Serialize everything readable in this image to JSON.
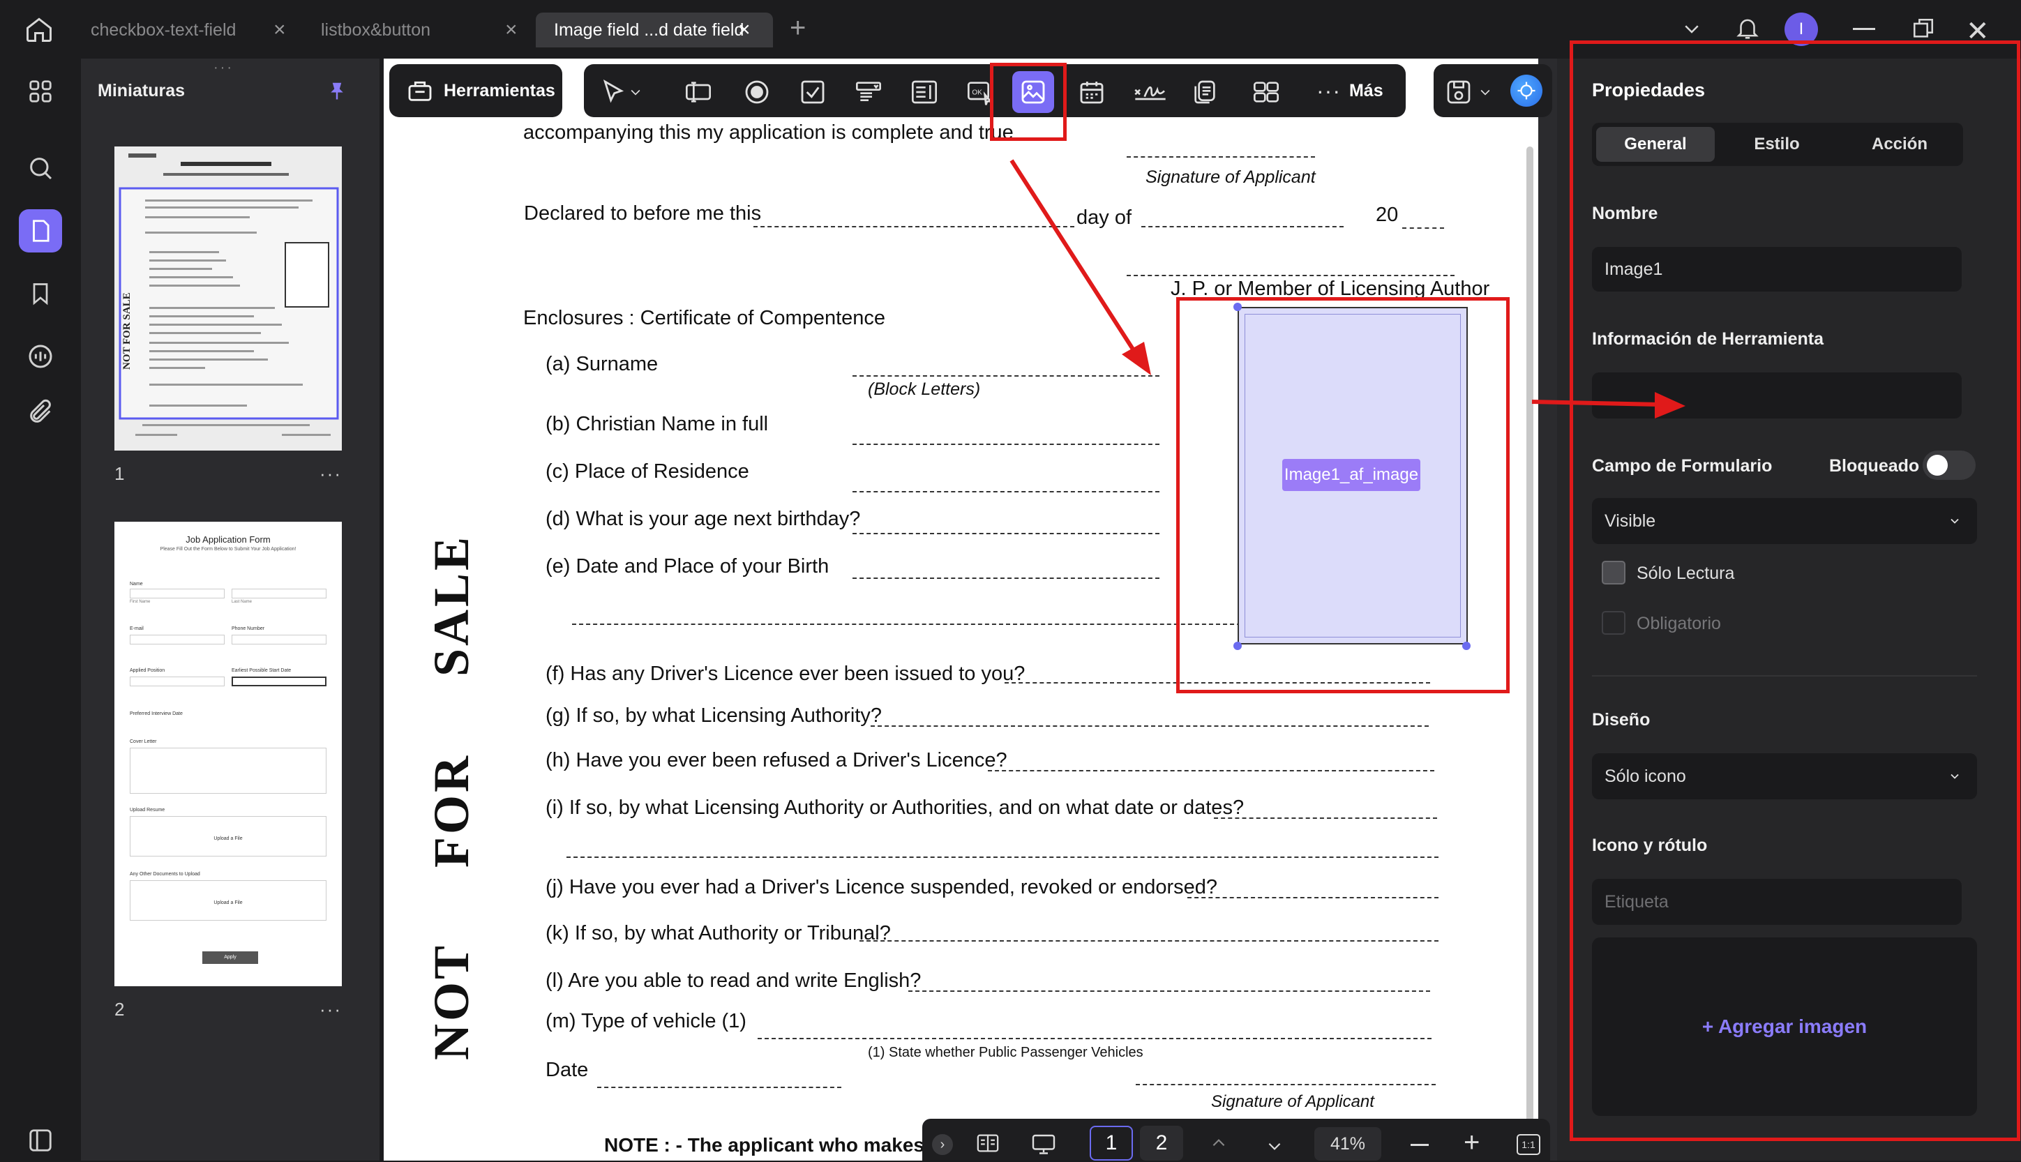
{
  "tabs": [
    {
      "label": "checkbox-text-field"
    },
    {
      "label": "listbox&button"
    },
    {
      "label": "Image field ...d date field"
    }
  ],
  "user_initial": "I",
  "thumbnails": {
    "title": "Miniaturas",
    "pages": [
      {
        "number": "1",
        "more": "···"
      },
      {
        "number": "2",
        "more": "···"
      }
    ],
    "page2": {
      "title": "Job Application Form",
      "subtitle": "Please Fill Out the Form Below to Submit Your Job Application!",
      "name": "Name",
      "first": "First Name",
      "last": "Last Name",
      "email": "E-mail",
      "phone": "Phone Number",
      "position": "Applied Position",
      "start": "Earliest Possible Start Date",
      "interview": "Preferred Interview Date",
      "cover": "Cover Letter",
      "resume": "Upload Resume",
      "other": "Any Other Documents to Upload",
      "upload": "Upload a File",
      "apply": "Apply"
    }
  },
  "toolbar": {
    "tools_label": "Herramientas",
    "more_label": "Más"
  },
  "document": {
    "l_intro": "accompanying this my application is complete and true",
    "sig1": "Signature of Applicant",
    "declared": "Declared to before me this",
    "day_of": "day of",
    "year": "20",
    "jp": "J. P. or Member of Licensing Author",
    "enclosures": "Enclosures :  Certificate of Compentence",
    "a": "(a)  Surname",
    "block": "(Block Letters)",
    "b": "(b)  Christian Name in full",
    "c": "(c)  Place of Residence",
    "d": "(d)  What is your age next birthday?",
    "e": "(e)  Date and Place of your Birth",
    "f": "(f)  Has any Driver's Licence ever been issued to you?",
    "g": "(g)  If so, by what Licensing Authority?",
    "h": "(h)  Have you ever been refused a Driver's Licence?",
    "i": "(i)  If so, by what Licensing Authority or Authorities, and on what date or dates?",
    "j": "(j)  Have you ever had a Driver's Licence suspended, revoked or endorsed?",
    "k": "(k)  If so, by what Authority or Tribunal?",
    "l": "(l)  Are you able to read and write English?",
    "m": "(m)  Type of vehicle (1)",
    "state": "(1) State whether Public Passenger Vehicles",
    "date": "Date",
    "sig2": "Signature of Applicant",
    "note": "NOTE : - The applicant who makes",
    "side_not": "NOT",
    "side_for": "FOR",
    "side_sale": "SALE",
    "image_field": "Image1_af_image"
  },
  "pagebar": {
    "page1": "1",
    "page2": "2",
    "zoom": "41%"
  },
  "properties": {
    "title": "Propiedades",
    "tabs": [
      "General",
      "Estilo",
      "Acción"
    ],
    "name_label": "Nombre",
    "name_value": "Image1",
    "tooltip_label": "Información de Herramienta",
    "tooltip_value": "",
    "form_field_label": "Campo de Formulario",
    "locked_label": "Bloqueado",
    "visibility": "Visible",
    "readonly": "Sólo Lectura",
    "required": "Obligatorio",
    "design_label": "Diseño",
    "layout": "Sólo icono",
    "icon_label": "Icono y rótulo",
    "caption_placeholder": "Etiqueta",
    "add_image": "+ Agregar imagen"
  },
  "colors": {
    "accent": "#7a6cf5",
    "annotation": "#e01a1a",
    "panel": "#262628",
    "field_fill": "#dcdcfa"
  }
}
